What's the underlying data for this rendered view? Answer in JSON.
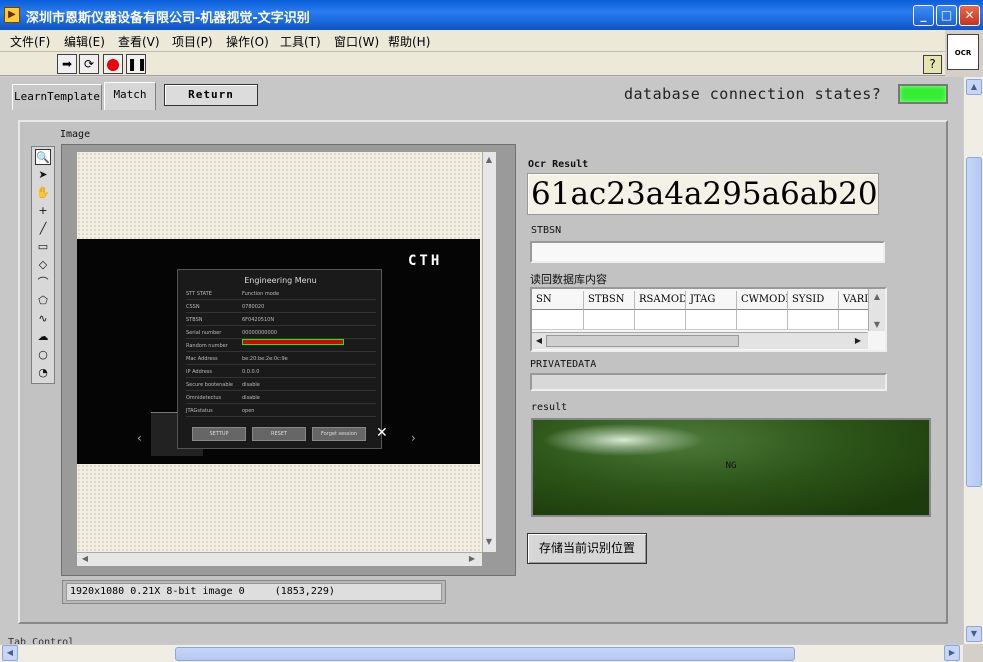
{
  "window": {
    "title": "深圳市恩斯仪器设备有限公司-机器视觉-文字识别",
    "minimize": "_",
    "maximize": "□",
    "close": "✕"
  },
  "menu": [
    "文件(F)",
    "编辑(E)",
    "查看(V)",
    "项目(P)",
    "操作(O)",
    "工具(T)",
    "窗口(W)",
    "帮助(H)"
  ],
  "toolbar": {
    "ocr_icon_label": "OCR",
    "help": "?"
  },
  "tabs": {
    "learn": "LearnTemplate",
    "match": "Match"
  },
  "return_label": "Return",
  "db_status": {
    "label": "database connection states?",
    "color": "#33ee33"
  },
  "image": {
    "label": "Image",
    "status": "1920x1080 0.21X 8-bit image 0     (1853,229)",
    "photo": {
      "brand": "CTH",
      "menu_title": "Engineering Menu",
      "rows": [
        {
          "key": "STT STATE",
          "val": "Function mode"
        },
        {
          "key": "CSSN",
          "val": "0780020"
        },
        {
          "key": "STBSN",
          "val": "6F0420510N"
        },
        {
          "key": "Serial number",
          "val": "00000000000"
        },
        {
          "key": "Random number",
          "val": ""
        },
        {
          "key": "Mac Address",
          "val": "be:20:be:2e:0c:9e"
        },
        {
          "key": "IP Address",
          "val": "0.0.0.0"
        },
        {
          "key": "Secure bootenable",
          "val": "disable"
        },
        {
          "key": "Omnidetectus",
          "val": "disable"
        },
        {
          "key": "JTAGstatus",
          "val": "open"
        }
      ],
      "buttons": [
        "SETTUP",
        "RESET",
        "Forget session"
      ]
    }
  },
  "ocr": {
    "label": "Ocr Result",
    "value": "61ac23a4a295a6ab20"
  },
  "stbsn": {
    "label": "STBSN",
    "value": ""
  },
  "db_table": {
    "label": "读回数据库内容",
    "columns": [
      "SN",
      "STBSN",
      "RSAMODE",
      "JTAG",
      "CWMODE",
      "SYSID",
      "VARI"
    ]
  },
  "privatedata": {
    "label": "PRIVATEDATA",
    "value": ""
  },
  "result": {
    "label": "result",
    "value": "NG"
  },
  "save_button": "存储当前识别位置",
  "tab_control_label": "Tab Control"
}
